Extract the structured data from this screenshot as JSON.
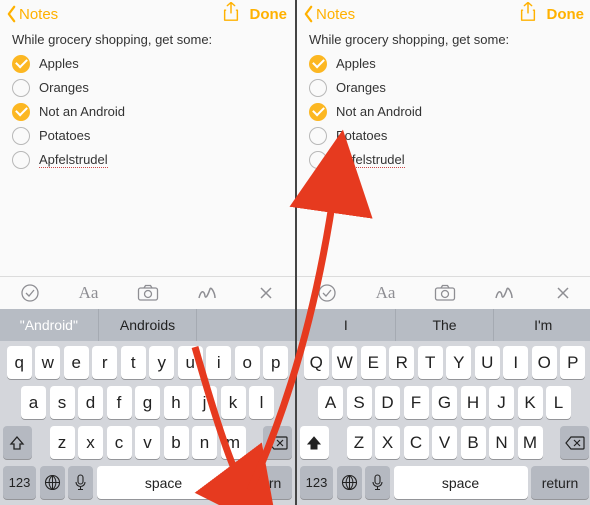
{
  "left": {
    "header": {
      "back_label": "Notes",
      "done_label": "Done"
    },
    "note": {
      "intro": "While grocery shopping, get some:",
      "items": [
        {
          "label": "Apples",
          "checked": true
        },
        {
          "label": "Oranges",
          "checked": false
        },
        {
          "label": "Not an Android",
          "checked": true
        },
        {
          "label": "Potatoes",
          "checked": false
        },
        {
          "label": "Apfelstrudel",
          "checked": false,
          "dotted": true
        }
      ]
    },
    "suggestions": {
      "a": "\"Android\"",
      "b": "Androids",
      "c": ""
    },
    "keyboard": {
      "row1": [
        "q",
        "w",
        "e",
        "r",
        "t",
        "y",
        "u",
        "i",
        "o",
        "p"
      ],
      "row2": [
        "a",
        "s",
        "d",
        "f",
        "g",
        "h",
        "j",
        "k",
        "l"
      ],
      "row3": [
        "z",
        "x",
        "c",
        "v",
        "b",
        "n",
        "m"
      ],
      "nums": "123",
      "space": "space",
      "ret": "return"
    }
  },
  "right": {
    "header": {
      "back_label": "Notes",
      "done_label": "Done"
    },
    "note": {
      "intro": "While grocery shopping, get some:",
      "items": [
        {
          "label": "Apples",
          "checked": true
        },
        {
          "label": "Oranges",
          "checked": false
        },
        {
          "label": "Not an Android",
          "checked": true
        },
        {
          "label": "Potatoes",
          "checked": false
        },
        {
          "label": "Apfelstrudel",
          "checked": false,
          "dotted": true
        },
        {
          "label": "",
          "checked": false,
          "cursor": true
        }
      ]
    },
    "suggestions": {
      "a": "I",
      "b": "The",
      "c": "I'm"
    },
    "keyboard": {
      "row1": [
        "Q",
        "W",
        "E",
        "R",
        "T",
        "Y",
        "U",
        "I",
        "O",
        "P"
      ],
      "row2": [
        "A",
        "S",
        "D",
        "F",
        "G",
        "H",
        "J",
        "K",
        "L"
      ],
      "row3": [
        "Z",
        "X",
        "C",
        "V",
        "B",
        "N",
        "M"
      ],
      "nums": "123",
      "space": "space",
      "ret": "return"
    }
  }
}
